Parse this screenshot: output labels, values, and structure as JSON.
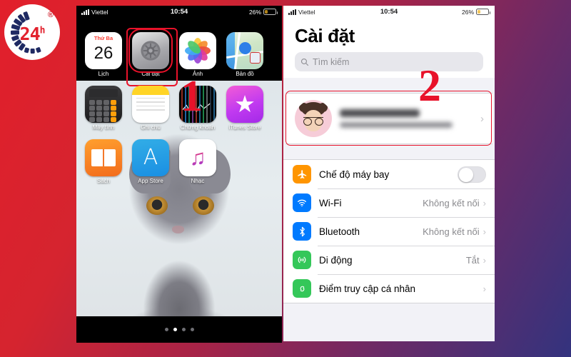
{
  "brand": {
    "logo_text": "24",
    "logo_sup": "h",
    "registered": "®"
  },
  "phone_left": {
    "status": {
      "carrier": "Viettel",
      "time": "10:54",
      "battery": "26%",
      "signal_icon": "signal-bars-icon",
      "battery_icon": "battery-icon"
    },
    "apps": [
      [
        {
          "label": "Lịch",
          "icon": "calendar-icon",
          "day_name": "Thứ Ba",
          "day_number": "26",
          "selected": false
        },
        {
          "label": "Cài đặt",
          "icon": "settings-gear-icon",
          "selected": true
        },
        {
          "label": "Ảnh",
          "icon": "photos-icon",
          "selected": false
        },
        {
          "label": "Bản đồ",
          "icon": "maps-icon",
          "selected": false
        }
      ],
      [
        {
          "label": "Máy tính",
          "icon": "calculator-icon",
          "selected": false
        },
        {
          "label": "Ghi chú",
          "icon": "notes-icon",
          "selected": false
        },
        {
          "label": "Chứng khoán",
          "icon": "stocks-icon",
          "selected": false
        },
        {
          "label": "iTunes Store",
          "icon": "itunes-store-icon",
          "selected": false
        }
      ],
      [
        {
          "label": "Sách",
          "icon": "books-icon",
          "selected": false
        },
        {
          "label": "App Store",
          "icon": "app-store-icon",
          "selected": false
        },
        {
          "label": "Nhạc",
          "icon": "music-icon",
          "selected": false
        }
      ]
    ],
    "page_dots": {
      "count": 4,
      "active_index": 1
    },
    "wallpaper": "grey-cat-photo"
  },
  "phone_right": {
    "status": {
      "carrier": "Viettel",
      "time": "10:54",
      "battery": "26%"
    },
    "title": "Cài đặt",
    "search": {
      "placeholder": "Tìm kiếm",
      "icon": "search-icon"
    },
    "apple_id": {
      "name_redacted": true,
      "subtitle_redacted": true,
      "avatar_icon": "memoji-avatar",
      "chevron": "›"
    },
    "rows": [
      {
        "label": "Chế độ máy bay",
        "icon": "airplane-icon",
        "icon_color": "#ff9500",
        "control": "toggle",
        "toggle_on": false
      },
      {
        "label": "Wi-Fi",
        "icon": "wifi-icon",
        "icon_color": "#007aff",
        "value": "Không kết nối",
        "chevron": "›"
      },
      {
        "label": "Bluetooth",
        "icon": "bluetooth-icon",
        "icon_color": "#007aff",
        "value": "Không kết nối",
        "chevron": "›"
      },
      {
        "label": "Di động",
        "icon": "cellular-icon",
        "icon_color": "#34c759",
        "value": "Tắt",
        "chevron": "›"
      },
      {
        "label": "Điểm truy cập cá nhân",
        "icon": "hotspot-icon",
        "icon_color": "#34c759",
        "value": "",
        "chevron": "›"
      }
    ]
  },
  "annotations": {
    "step_one": "1",
    "step_two": "2",
    "highlight_color": "#e8122a"
  },
  "background": {
    "gradient_from": "#e21f2b",
    "gradient_to": "#33337e"
  }
}
